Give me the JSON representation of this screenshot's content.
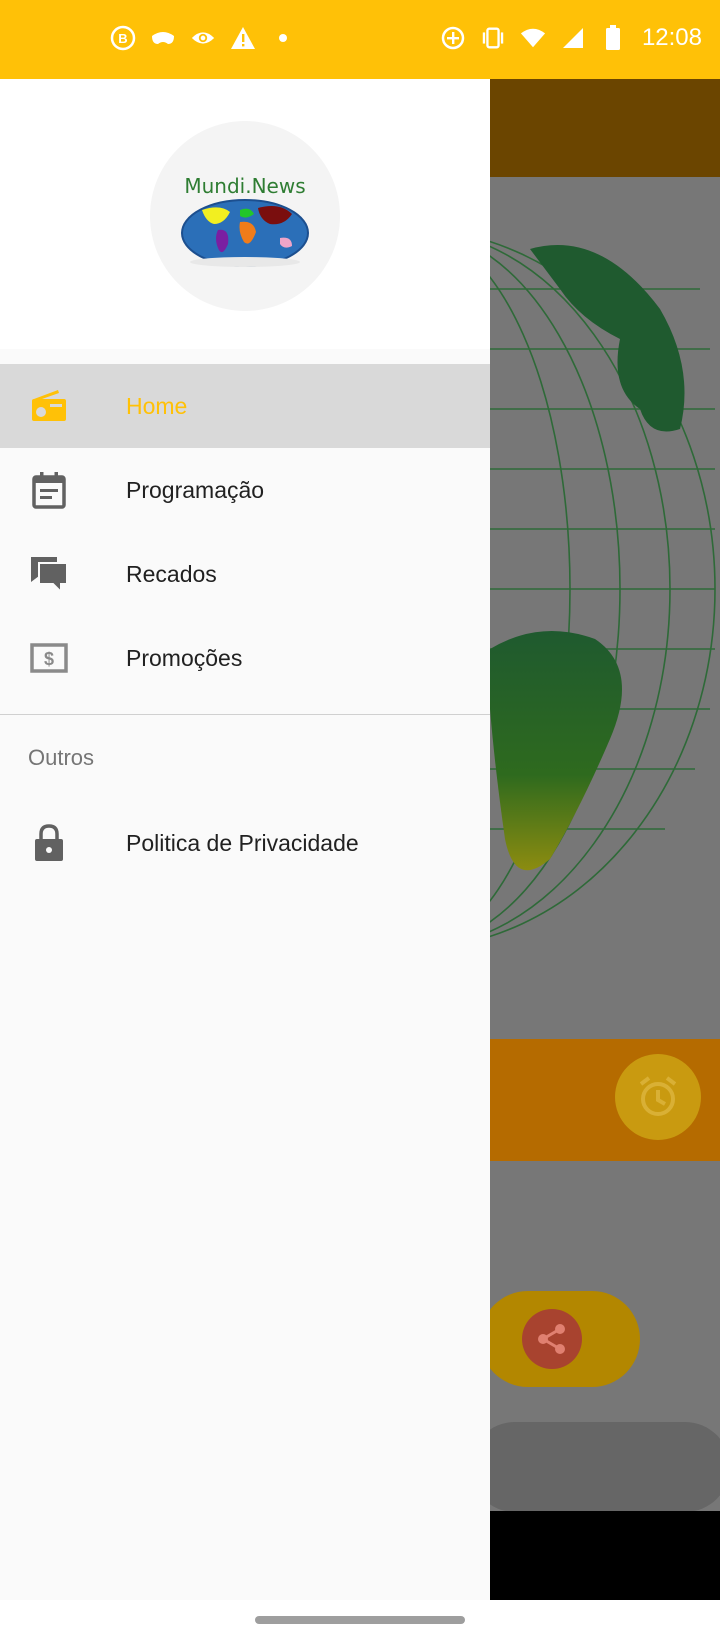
{
  "status_bar": {
    "time": "12:08",
    "left_icons": [
      "b-badge-icon",
      "mask-icon",
      "eye-icon",
      "warning-icon",
      "dot-icon"
    ],
    "right_icons": [
      "data-saver-icon",
      "vibrate-icon",
      "wifi-icon",
      "signal-icon",
      "battery-icon"
    ],
    "color": "#FFC107"
  },
  "drawer": {
    "logo_text": "Mundi.News",
    "menu": [
      {
        "label": "Home",
        "icon": "radio-icon",
        "active": true
      },
      {
        "label": "Programação",
        "icon": "calendar-icon",
        "active": false
      },
      {
        "label": "Recados",
        "icon": "chat-icon",
        "active": false
      },
      {
        "label": "Promoções",
        "icon": "money-icon",
        "active": false
      }
    ],
    "section_title": "Outros",
    "other_items": [
      {
        "label": "Politica de Privacidade",
        "icon": "lock-icon"
      }
    ],
    "accent_color": "#FFC107"
  }
}
